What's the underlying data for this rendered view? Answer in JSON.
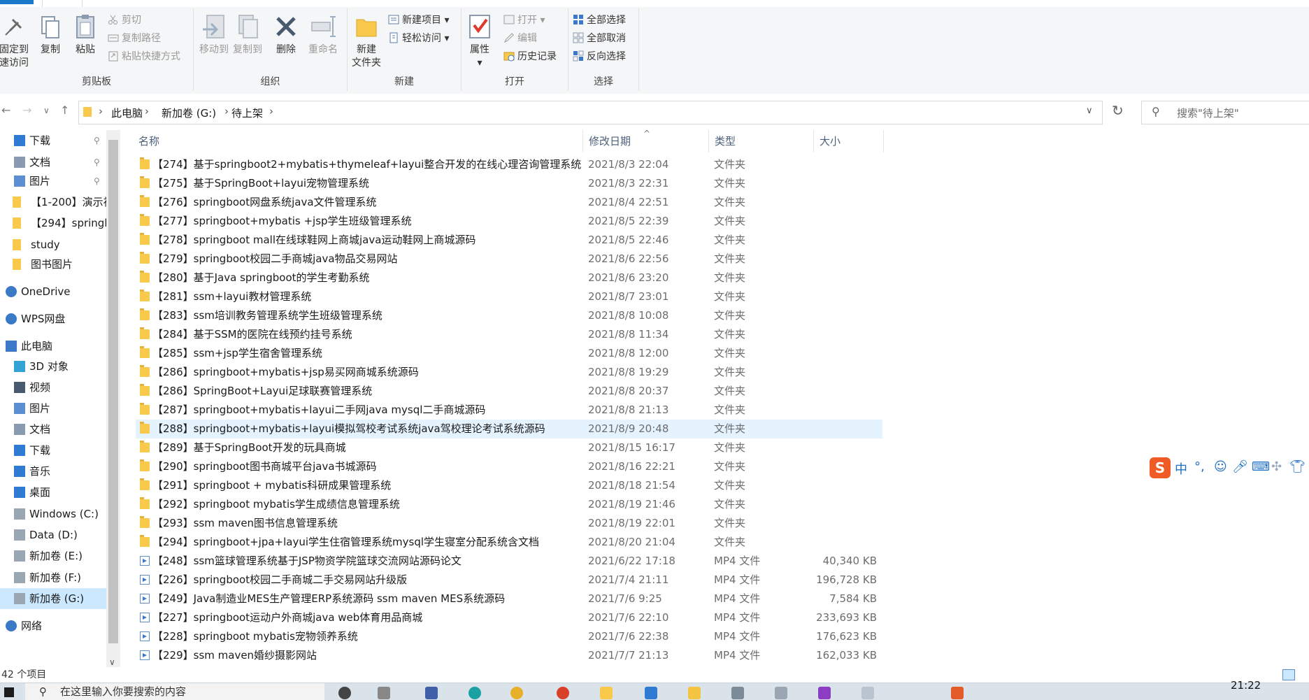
{
  "colors": {
    "accent": "#1979ca",
    "selection": "#cce8ff",
    "hover": "#e5f3ff",
    "folder": "#f8c94a",
    "ime": "#f05a24"
  },
  "ribbon": {
    "clipboard": {
      "pin_line1": "固定到",
      "pin_line2": "速访问",
      "copy": "复制",
      "paste": "粘贴",
      "cut": "剪切",
      "copy_path": "复制路径",
      "paste_shortcut": "粘贴快捷方式",
      "label": "剪贴板"
    },
    "organize": {
      "move_to": "移动到",
      "copy_to": "复制到",
      "delete": "删除",
      "rename": "重命名",
      "label": "组织"
    },
    "new": {
      "new_folder_line1": "新建",
      "new_folder_line2": "文件夹",
      "new_item": "新建项目",
      "easy_access": "轻松访问",
      "label": "新建"
    },
    "open": {
      "properties": "属性",
      "open": "打开",
      "edit": "编辑",
      "history": "历史记录",
      "label": "打开"
    },
    "select": {
      "select_all": "全部选择",
      "select_none": "全部取消",
      "invert": "反向选择",
      "label": "选择"
    }
  },
  "address": {
    "crumbs": [
      "此电脑",
      "新加卷 (G:)",
      "待上架"
    ],
    "search_placeholder": "搜索\"待上架\""
  },
  "nav": {
    "items": [
      {
        "label": "下载",
        "icon": "download-icon",
        "pinned": true
      },
      {
        "label": "文档",
        "icon": "document-icon",
        "pinned": true
      },
      {
        "label": "图片",
        "icon": "picture-icon",
        "pinned": true
      },
      {
        "label": "【1-200】演示视",
        "icon": "folder-icon"
      },
      {
        "label": "【294】springb",
        "icon": "folder-icon"
      },
      {
        "label": "study",
        "icon": "folder-icon"
      },
      {
        "label": "图书图片",
        "icon": "folder-icon"
      },
      {
        "label": "OneDrive",
        "icon": "cloud-icon"
      },
      {
        "label": "WPS网盘",
        "icon": "cloud-icon"
      },
      {
        "label": "此电脑",
        "icon": "computer-icon"
      },
      {
        "label": "3D 对象",
        "icon": "cube-icon"
      },
      {
        "label": "视频",
        "icon": "video-icon"
      },
      {
        "label": "图片",
        "icon": "picture-icon"
      },
      {
        "label": "文档",
        "icon": "document-icon"
      },
      {
        "label": "下载",
        "icon": "download-icon"
      },
      {
        "label": "音乐",
        "icon": "music-icon"
      },
      {
        "label": "桌面",
        "icon": "desktop-icon"
      },
      {
        "label": "Windows (C:)",
        "icon": "drive-icon"
      },
      {
        "label": "Data (D:)",
        "icon": "drive-icon"
      },
      {
        "label": "新加卷 (E:)",
        "icon": "drive-icon"
      },
      {
        "label": "新加卷 (F:)",
        "icon": "drive-icon"
      },
      {
        "label": "新加卷 (G:)",
        "icon": "drive-icon",
        "selected": true
      },
      {
        "label": "网络",
        "icon": "network-icon"
      }
    ]
  },
  "list": {
    "columns": [
      "名称",
      "修改日期",
      "类型",
      "大小"
    ],
    "rows": [
      {
        "name": "【274】基于springboot2+mybatis+thymeleaf+layui整合开发的在线心理咨询管理系统",
        "date": "2021/8/3 22:04",
        "type": "文件夹",
        "size": "",
        "kind": "folder"
      },
      {
        "name": "【275】基于SpringBoot+layui宠物管理系统",
        "date": "2021/8/3 22:31",
        "type": "文件夹",
        "size": "",
        "kind": "folder"
      },
      {
        "name": "【276】springboot网盘系统java文件管理系统",
        "date": "2021/8/4 22:51",
        "type": "文件夹",
        "size": "",
        "kind": "folder"
      },
      {
        "name": "【277】springboot+mybatis +jsp学生班级管理系统",
        "date": "2021/8/5 22:39",
        "type": "文件夹",
        "size": "",
        "kind": "folder"
      },
      {
        "name": "【278】springboot mall在线球鞋网上商城java运动鞋网上商城源码",
        "date": "2021/8/5 22:46",
        "type": "文件夹",
        "size": "",
        "kind": "folder"
      },
      {
        "name": "【279】springboot校园二手商城java物品交易网站",
        "date": "2021/8/6 22:56",
        "type": "文件夹",
        "size": "",
        "kind": "folder"
      },
      {
        "name": "【280】基于Java springboot的学生考勤系统",
        "date": "2021/8/6 23:20",
        "type": "文件夹",
        "size": "",
        "kind": "folder"
      },
      {
        "name": "【281】ssm+layui教材管理系统",
        "date": "2021/8/7 23:01",
        "type": "文件夹",
        "size": "",
        "kind": "folder"
      },
      {
        "name": "【283】ssm培训教务管理系统学生班级管理系统",
        "date": "2021/8/8 10:08",
        "type": "文件夹",
        "size": "",
        "kind": "folder"
      },
      {
        "name": "【284】基于SSM的医院在线预约挂号系统",
        "date": "2021/8/8 11:34",
        "type": "文件夹",
        "size": "",
        "kind": "folder"
      },
      {
        "name": "【285】ssm+jsp学生宿舍管理系统",
        "date": "2021/8/8 12:00",
        "type": "文件夹",
        "size": "",
        "kind": "folder"
      },
      {
        "name": "【286】springboot+mybatis+jsp易买网商城系统源码",
        "date": "2021/8/8 19:29",
        "type": "文件夹",
        "size": "",
        "kind": "folder"
      },
      {
        "name": "【286】SpringBoot+Layui足球联赛管理系统",
        "date": "2021/8/8 20:37",
        "type": "文件夹",
        "size": "",
        "kind": "folder"
      },
      {
        "name": "【287】springboot+mybatis+layui二手网java mysql二手商城源码",
        "date": "2021/8/8 21:13",
        "type": "文件夹",
        "size": "",
        "kind": "folder"
      },
      {
        "name": "【288】springboot+mybatis+layui模拟驾校考试系统java驾校理论考试系统源码",
        "date": "2021/8/9 20:48",
        "type": "文件夹",
        "size": "",
        "kind": "folder",
        "hover": true
      },
      {
        "name": "【289】基于SpringBoot开发的玩具商城",
        "date": "2021/8/15 16:17",
        "type": "文件夹",
        "size": "",
        "kind": "folder"
      },
      {
        "name": "【290】springboot图书商城平台java书城源码",
        "date": "2021/8/16 22:21",
        "type": "文件夹",
        "size": "",
        "kind": "folder"
      },
      {
        "name": "【291】springboot + mybatis科研成果管理系统",
        "date": "2021/8/18 21:54",
        "type": "文件夹",
        "size": "",
        "kind": "folder"
      },
      {
        "name": "【292】springboot mybatis学生成绩信息管理系统",
        "date": "2021/8/19 21:46",
        "type": "文件夹",
        "size": "",
        "kind": "folder"
      },
      {
        "name": "【293】ssm maven图书信息管理系统",
        "date": "2021/8/19 22:01",
        "type": "文件夹",
        "size": "",
        "kind": "folder"
      },
      {
        "name": "【294】springboot+jpa+layui学生住宿管理系统mysql学生寝室分配系统含文档",
        "date": "2021/8/20 21:04",
        "type": "文件夹",
        "size": "",
        "kind": "folder"
      },
      {
        "name": "【248】ssm篮球管理系统基于JSP物资学院篮球交流网站源码论文",
        "date": "2021/6/22 17:18",
        "type": "MP4 文件",
        "size": "40,340 KB",
        "kind": "mp4"
      },
      {
        "name": "【226】springboot校园二手商城二手交易网站升级版",
        "date": "2021/7/4 21:11",
        "type": "MP4 文件",
        "size": "196,728 KB",
        "kind": "mp4"
      },
      {
        "name": "【249】Java制造业MES生产管理ERP系统源码 ssm maven MES系统源码",
        "date": "2021/7/6 9:25",
        "type": "MP4 文件",
        "size": "7,584 KB",
        "kind": "mp4"
      },
      {
        "name": "【227】springboot运动户外商城java web体育用品商城",
        "date": "2021/7/6 22:10",
        "type": "MP4 文件",
        "size": "233,693 KB",
        "kind": "mp4"
      },
      {
        "name": "【228】springboot mybatis宠物领养系统",
        "date": "2021/7/6 22:38",
        "type": "MP4 文件",
        "size": "176,623 KB",
        "kind": "mp4"
      },
      {
        "name": "【229】ssm maven婚纱摄影网站",
        "date": "2021/7/7 21:13",
        "type": "MP4 文件",
        "size": "162,033 KB",
        "kind": "mp4"
      }
    ]
  },
  "status": {
    "count": "42 个项目"
  },
  "taskbar": {
    "search_text": "在这里输入你要搜索的内容",
    "time": "21:22"
  },
  "ime": {
    "mode": "中",
    "punct": "°,"
  }
}
